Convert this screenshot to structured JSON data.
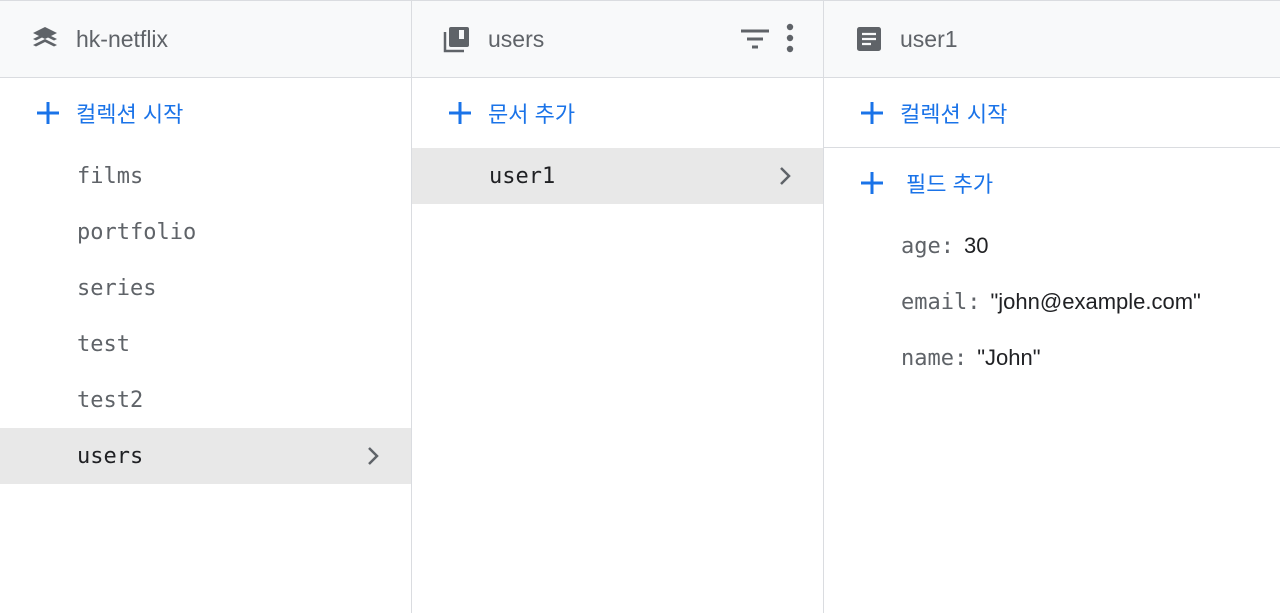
{
  "colors": {
    "accent": "#1a73e8",
    "selected_bg": "#e8e8e8",
    "muted": "#5f6368"
  },
  "panels": {
    "root": {
      "title": "hk-netflix",
      "icon": "firestore-stack-icon",
      "add_label": "컬렉션 시작",
      "collections": [
        "films",
        "portfolio",
        "series",
        "test",
        "test2",
        "users"
      ],
      "selected": "users"
    },
    "collection": {
      "title": "users",
      "icon": "collection-icon",
      "add_label": "문서 추가",
      "documents": [
        "user1"
      ],
      "selected": "user1"
    },
    "document": {
      "title": "user1",
      "icon": "document-icon",
      "add_collection_label": "컬렉션 시작",
      "add_field_label": "필드 추가",
      "fields": [
        {
          "key": "age:",
          "value": "30"
        },
        {
          "key": "email:",
          "value": "\"john@example.com\""
        },
        {
          "key": "name:",
          "value": "\"John\""
        }
      ]
    }
  }
}
